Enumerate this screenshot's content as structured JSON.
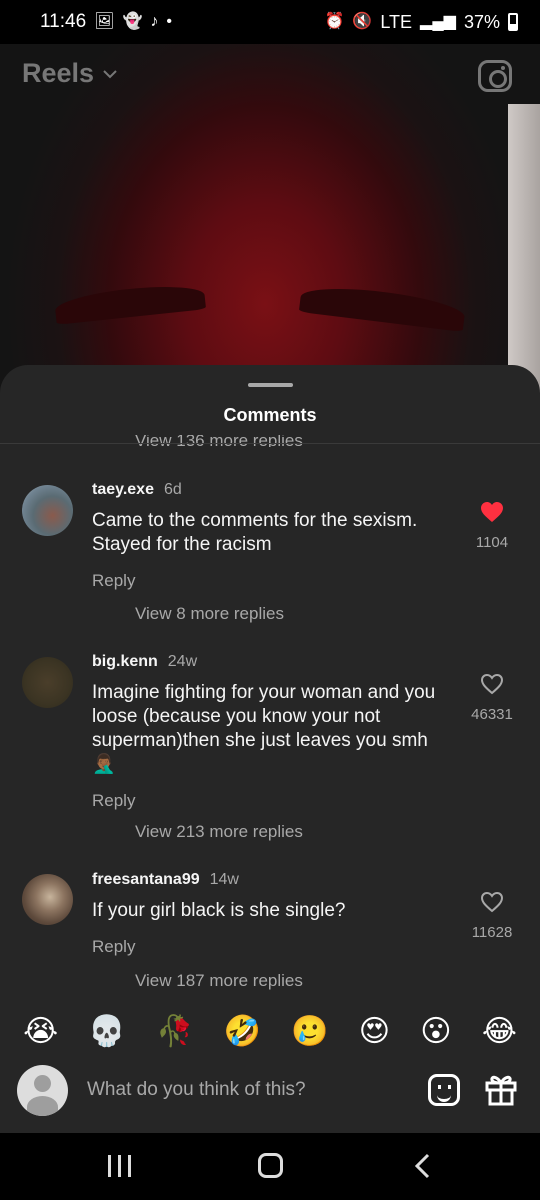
{
  "status_bar": {
    "time": "11:46",
    "network": "LTE",
    "battery": "37%",
    "notification_icons": [
      "gallery-icon",
      "snapchat-icon",
      "tiktok-icon",
      "dot-icon"
    ],
    "system_icons": [
      "alarm-icon",
      "mute-icon",
      "signal-icon",
      "battery-icon"
    ]
  },
  "reel": {
    "header_label": "Reels",
    "header_icon": "chevron-down-icon",
    "camera_icon": "camera-icon"
  },
  "comments_sheet": {
    "title": "Comments",
    "cut_off_replies": "View 136 more replies",
    "comments": [
      {
        "username": "taey.exe",
        "time": "6d",
        "text": "Came to the comments for the sexism. Stayed for the racism",
        "reply_label": "Reply",
        "likes": "1104",
        "liked": true,
        "view_replies": "View 8 more replies"
      },
      {
        "username": "big.kenn",
        "time": "24w",
        "text": "Imagine fighting for your woman and you loose (because you know your not superman)then she just leaves you smh 🤦🏾‍♂️",
        "reply_label": "Reply",
        "likes": "46331",
        "liked": false,
        "view_replies": "View 213 more replies"
      },
      {
        "username": "freesantana99",
        "time": "14w",
        "text": "If your girl black is she single?",
        "reply_label": "Reply",
        "likes": "11628",
        "liked": false,
        "view_replies": "View 187 more replies"
      }
    ]
  },
  "emoji_bar": [
    "😭",
    "💀",
    "🥀",
    "🤣",
    "🥲",
    "😍",
    "😮",
    "😂"
  ],
  "composer": {
    "placeholder": "What do you think of this?",
    "sticker_icon": "sticker-icon",
    "gift_icon": "gift-icon"
  },
  "colors": {
    "sheet_bg": "#262626",
    "secondary_text": "#a8a8a8",
    "like_red": "#ff3040"
  }
}
